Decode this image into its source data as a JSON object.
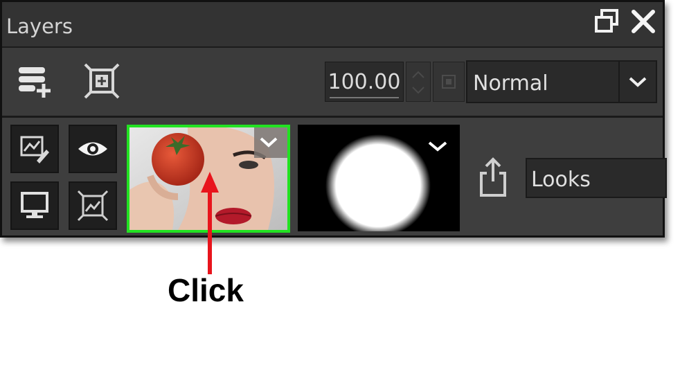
{
  "panel": {
    "title": "Layers",
    "window_buttons": {
      "restore_icon": "restore-icon",
      "close_icon": "close-icon"
    }
  },
  "toolbar": {
    "new_layer_icon": "add-layer-icon",
    "fit_icon": "fit-to-canvas-icon",
    "opacity_value": "100.00",
    "blend_mode": "Normal",
    "blend_dropdown_icon": "chevron-down-icon"
  },
  "layer": {
    "controls": [
      "edit-layer-icon",
      "visibility-eye-icon",
      "display-monitor-icon",
      "fit-image-icon"
    ],
    "thumbnail_icon": "image-thumbnail",
    "mask_icon": "mask-thumbnail",
    "share_icon": "share-icon",
    "name": "Looks",
    "selected_border_color": "#22e222"
  },
  "annotation": {
    "label": "Click",
    "arrow_color": "#e8141c"
  }
}
